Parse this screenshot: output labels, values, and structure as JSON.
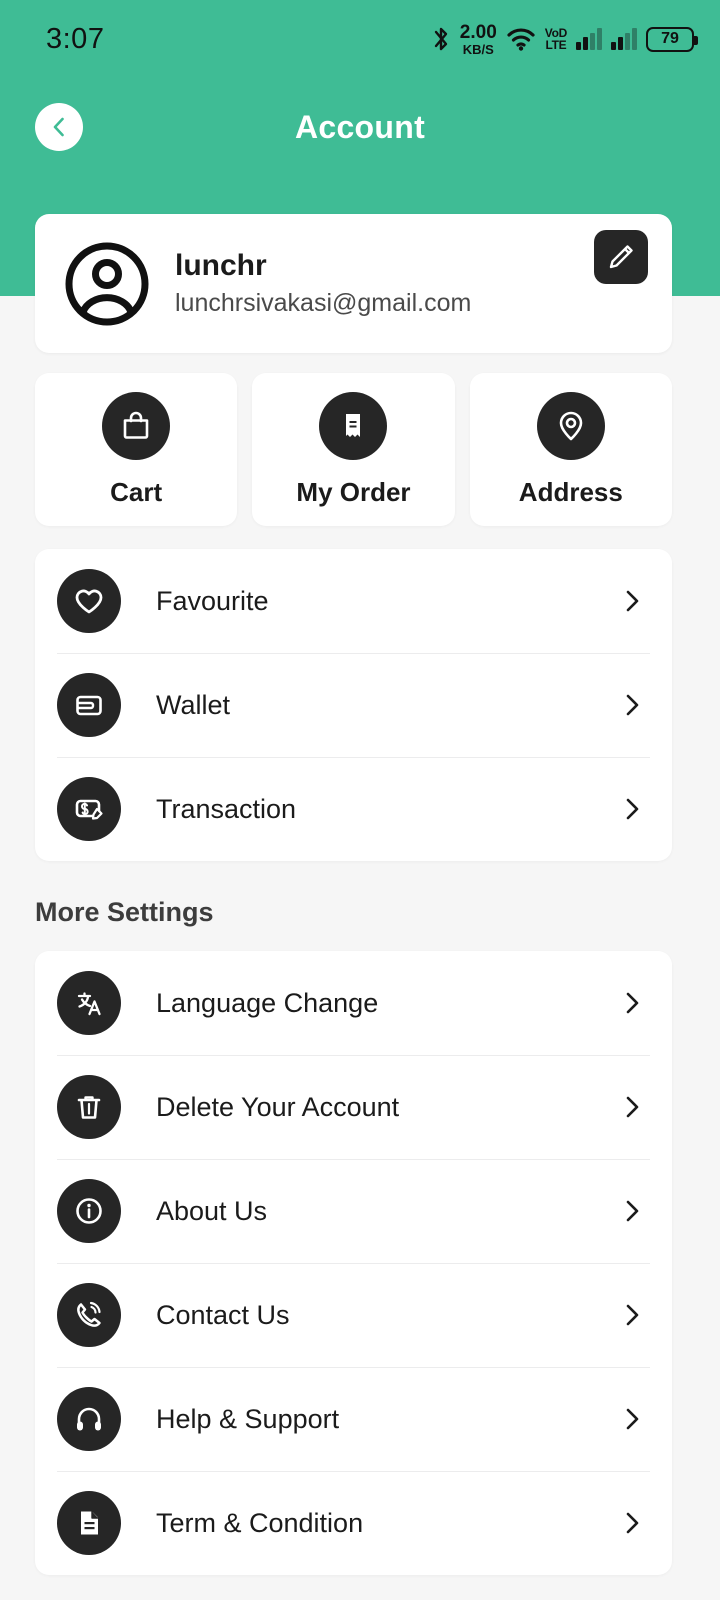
{
  "status_bar": {
    "time": "3:07",
    "bluetooth_icon": "bluetooth-icon",
    "data_speed_value": "2.00",
    "data_speed_unit": "KB/S",
    "wifi_icon": "wifi-icon",
    "volte_top": "VoD",
    "volte_bottom": "LTE",
    "signal_icon": "signal-bars-icon",
    "battery_level": "79"
  },
  "app_bar": {
    "back_icon": "chevron-left-icon",
    "title": "Account"
  },
  "profile": {
    "avatar_icon": "user-avatar-icon",
    "name": "lunchr",
    "email": "lunchrsivakasi@gmail.com",
    "edit_icon": "pencil-edit-icon"
  },
  "quick_actions": [
    {
      "label": "Cart",
      "icon": "shopping-bag-icon"
    },
    {
      "label": "My Order",
      "icon": "receipt-icon"
    },
    {
      "label": "Address",
      "icon": "location-pin-icon"
    }
  ],
  "main_menu": [
    {
      "label": "Favourite",
      "icon": "heart-icon",
      "chevron": "chevron-right-icon"
    },
    {
      "label": "Wallet",
      "icon": "wallet-icon",
      "chevron": "chevron-right-icon"
    },
    {
      "label": "Transaction",
      "icon": "transaction-icon",
      "chevron": "chevron-right-icon"
    }
  ],
  "more_settings": {
    "title": "More Settings",
    "items": [
      {
        "label": "Language Change",
        "icon": "translate-icon",
        "chevron": "chevron-right-icon"
      },
      {
        "label": "Delete Your Account",
        "icon": "trash-icon",
        "chevron": "chevron-right-icon"
      },
      {
        "label": "About Us",
        "icon": "info-icon",
        "chevron": "chevron-right-icon"
      },
      {
        "label": "Contact Us",
        "icon": "phone-call-icon",
        "chevron": "chevron-right-icon"
      },
      {
        "label": "Help & Support",
        "icon": "headphones-icon",
        "chevron": "chevron-right-icon"
      },
      {
        "label": "Term & Condition",
        "icon": "document-icon",
        "chevron": "chevron-right-icon"
      }
    ]
  },
  "colors": {
    "brand_green": "#3fbc95",
    "page_background": "#f6f6f6",
    "card_background": "#ffffff",
    "icon_circle": "#262626",
    "text_primary": "#1b1b1b",
    "text_secondary": "#4a4a4a"
  }
}
